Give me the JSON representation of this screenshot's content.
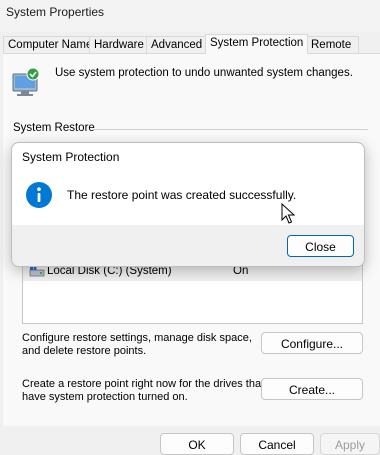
{
  "window": {
    "title": "System Properties"
  },
  "tabs": [
    {
      "label": "Computer Name"
    },
    {
      "label": "Hardware"
    },
    {
      "label": "Advanced"
    },
    {
      "label": "System Protection"
    },
    {
      "label": "Remote"
    }
  ],
  "intro": {
    "text": "Use system protection to undo unwanted system changes."
  },
  "restore": {
    "group_title": "System Restore"
  },
  "drives": [
    {
      "name": "Local Disk (C:) (System)",
      "protection": "On"
    }
  ],
  "configure": {
    "description_line1": "Configure restore settings, manage disk space,",
    "description_line2": "and delete restore points.",
    "button": "Configure..."
  },
  "create": {
    "description_line1": "Create a restore point right now for the drives that",
    "description_line2": "have system protection turned on.",
    "button": "Create..."
  },
  "footer": {
    "ok": "OK",
    "cancel": "Cancel",
    "apply": "Apply"
  },
  "dialog": {
    "title": "System Protection",
    "message": "The restore point was created successfully.",
    "close": "Close",
    "icon": "info-icon"
  },
  "colors": {
    "accent": "#0067c0",
    "info": "#0078d4"
  }
}
